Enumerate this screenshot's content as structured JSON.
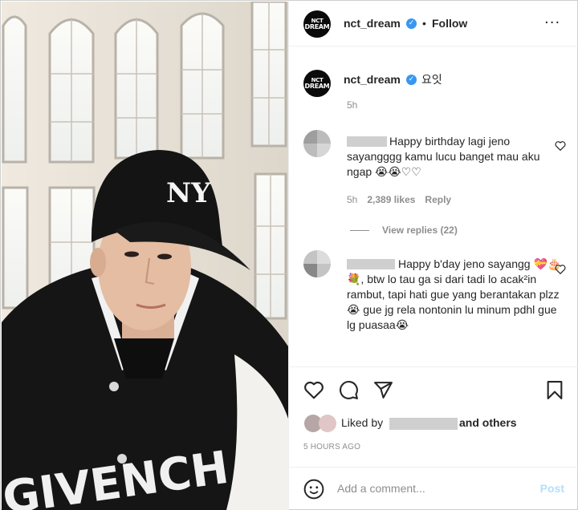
{
  "post": {
    "username": "nct_dream",
    "follow_label": "Follow",
    "dot": "•",
    "avatar_line1": "NCT",
    "avatar_line2": "DREAM",
    "caption": "요잇",
    "caption_time": "5h"
  },
  "comments": [
    {
      "text": "Happy birthday lagi jeno sayangggg kamu lucu banget mau aku ngap 😭😭♡♡",
      "time": "5h",
      "likes": "2,389 likes",
      "reply": "Reply",
      "view_replies": "View replies (22)"
    },
    {
      "text": "Happy b'day jeno sayangg 💝🎂💐, btw lo tau ga si dari tadi lo acak²in rambut, tapi hati gue yang berantakan plzz😭 gue jg rela nontonin lu minum pdhl gue lg puasaa😭"
    }
  ],
  "likes_section": {
    "liked_by": "Liked by",
    "and_others": "and others",
    "timestamp": "5 HOURS AGO"
  },
  "add_comment": {
    "placeholder": "Add a comment...",
    "post_label": "Post"
  },
  "colors": {
    "verified": "#3897f0",
    "post_disabled": "#b2dffc",
    "muted": "#8e8e8e"
  },
  "icons": [
    "heart-icon",
    "comment-icon",
    "share-icon",
    "bookmark-icon",
    "emoji-icon",
    "more-icon",
    "verified-badge-icon"
  ]
}
